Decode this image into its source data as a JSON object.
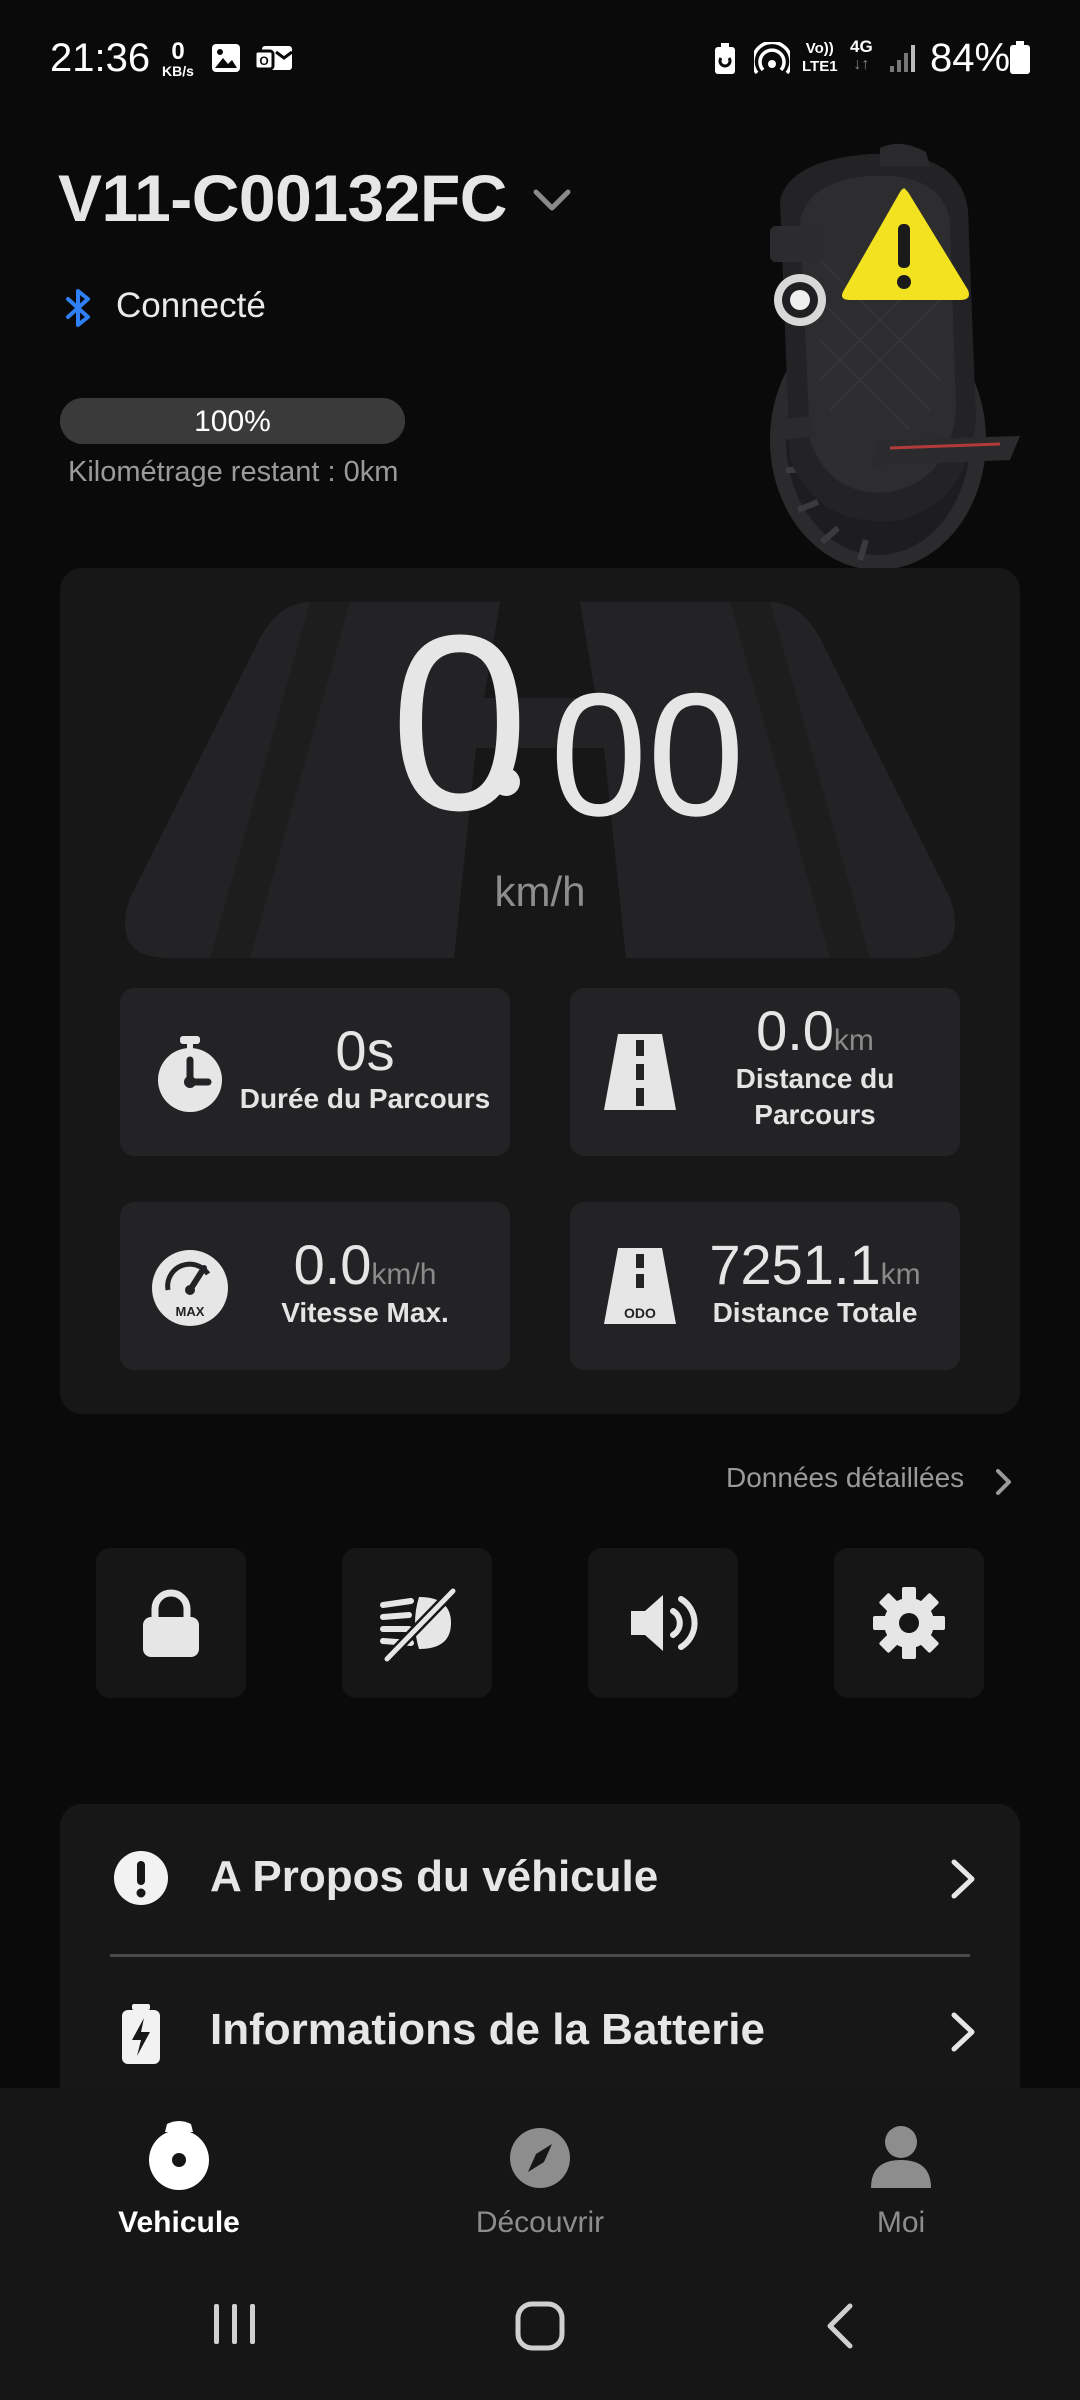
{
  "status_bar": {
    "time": "21:36",
    "net_speed_value": "0",
    "net_speed_unit": "KB/s",
    "volte_top": "Vo))",
    "volte_bottom": "LTE1",
    "network_type": "4G",
    "battery_percent": "84%",
    "icons": [
      "gallery-icon",
      "notification-icon",
      "battery-saver-icon",
      "hotspot-icon",
      "signal-icon",
      "battery-icon"
    ]
  },
  "header": {
    "vehicle_name": "V11-C00132FC",
    "connection_status": "Connecté",
    "battery_level_percent": 100,
    "battery_label": "100%",
    "remaining_range": "Kilométrage restant : 0km",
    "warning_icon": "warning-icon"
  },
  "dashboard": {
    "speed_integer": "0",
    "speed_decimal": "00",
    "speed_unit": "km/h",
    "stats": [
      {
        "value": "0s",
        "unit": "",
        "label": "Durée du Parcours",
        "icon": "stopwatch-icon"
      },
      {
        "value": "0.0",
        "unit": "km",
        "label": "Distance du Parcours",
        "icon": "road-icon"
      },
      {
        "value": "0.0",
        "unit": "km/h",
        "label": "Vitesse Max.",
        "icon": "speedometer-max-icon"
      },
      {
        "value": "7251.1",
        "unit": "km",
        "label": "Distance Totale",
        "icon": "odometer-road-icon"
      }
    ],
    "max_badge": "MAX",
    "odo_badge": "ODO"
  },
  "details_link": "Données détaillées",
  "actions": [
    {
      "name": "lock-button",
      "icon": "lock-icon"
    },
    {
      "name": "light-button",
      "icon": "headlight-off-icon"
    },
    {
      "name": "sound-button",
      "icon": "speaker-icon"
    },
    {
      "name": "settings-button",
      "icon": "gear-icon"
    }
  ],
  "info_list": [
    {
      "label": "A Propos du véhicule",
      "icon": "info-exclamation-icon"
    },
    {
      "label": "Informations de la Batterie",
      "icon": "battery-bolt-icon"
    }
  ],
  "bottom_nav": [
    {
      "label": "Vehicule",
      "icon": "wheel-icon",
      "active": true
    },
    {
      "label": "Découvrir",
      "icon": "compass-icon",
      "active": false
    },
    {
      "label": "Moi",
      "icon": "person-icon",
      "active": false
    }
  ],
  "colors": {
    "background": "#0a0a0a",
    "card": "#171718",
    "tile": "#232325",
    "bluetooth": "#2f7ff5",
    "warning": "#f3e21f",
    "nav_active": "#ffffff",
    "nav_inactive": "#8d8d8d"
  }
}
